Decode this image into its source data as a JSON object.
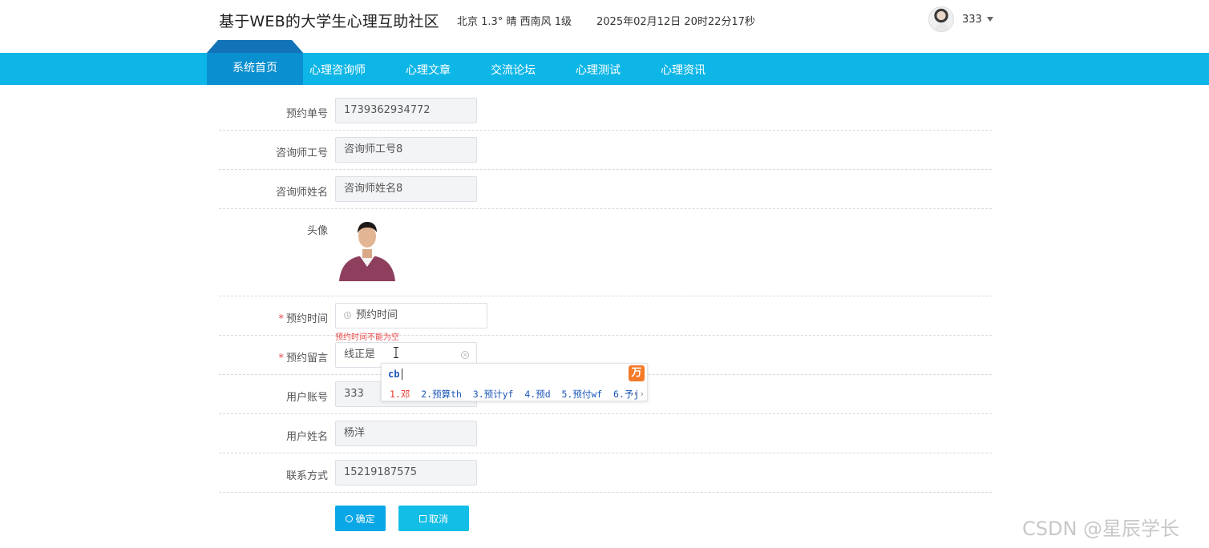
{
  "header": {
    "site_title": "基于WEB的大学生心理互助社区",
    "weather": "北京  1.3°  晴  西南风  1级",
    "datetime": "2025年02月12日 20时22分17秒",
    "user_name": "333"
  },
  "nav": {
    "items": [
      "系统首页",
      "心理咨询师",
      "心理文章",
      "交流论坛",
      "心理测试",
      "心理资讯"
    ]
  },
  "form": {
    "order_no": {
      "label": "预约单号",
      "value": "1739362934772"
    },
    "counselor_id": {
      "label": "咨询师工号",
      "value": "咨询师工号8"
    },
    "counselor_name": {
      "label": "咨询师姓名",
      "value": "咨询师姓名8"
    },
    "avatar": {
      "label": "头像"
    },
    "appointment_time": {
      "label": "预约时间",
      "placeholder": "预约时间",
      "error": "预约时间不能为空"
    },
    "appointment_message": {
      "label": "预约留言",
      "value": "线正是"
    },
    "user_account": {
      "label": "用户账号",
      "value": "333"
    },
    "user_name": {
      "label": "用户姓名",
      "value": "杨洋"
    },
    "contact": {
      "label": "联系方式",
      "value": "15219187575"
    },
    "required_mark": "*",
    "ok_button": "确定",
    "cancel_button": "取消"
  },
  "ime": {
    "code": "cb",
    "candidates": [
      "1.邓",
      "2.预算th",
      "3.预计yf",
      "4.预d",
      "5.预付wf",
      "6.予j"
    ]
  },
  "watermark": "CSDN @星辰学长",
  "colors": {
    "nav": "#0db6e6",
    "nav_home": "#0a8fd0",
    "primary_button": "#0aa7e6",
    "error": "#e84a4a"
  }
}
